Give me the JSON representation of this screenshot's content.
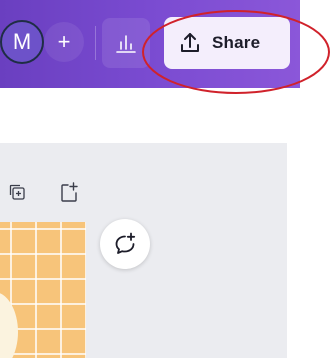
{
  "toolbar": {
    "avatar_initial": "M",
    "add_label": "+",
    "share_label": "Share"
  },
  "icons": {
    "avatar": "avatar",
    "add": "plus-icon",
    "insights": "bar-chart-icon",
    "share": "upload-icon",
    "duplicate": "duplicate-page-icon",
    "add_page": "add-page-icon",
    "comment": "add-comment-icon"
  },
  "colors": {
    "toolbar_purple": "#7a4bd1",
    "share_bg": "#f4eefc",
    "annotation_red": "#d0222b",
    "canvas_orange": "#f7c47a",
    "editor_bg": "#ebecf0"
  }
}
